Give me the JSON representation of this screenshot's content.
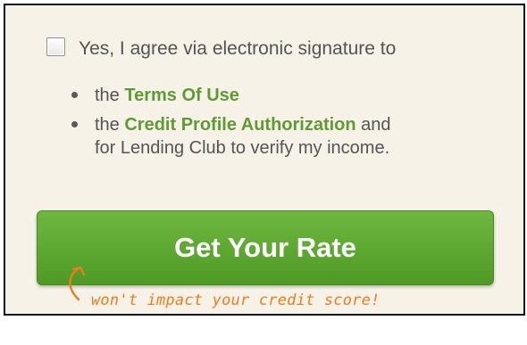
{
  "agreement": {
    "checked": false,
    "label": "Yes, I agree via electronic signature to"
  },
  "terms": [
    {
      "prefix": "the ",
      "link_text": "Terms Of Use",
      "suffix": ""
    },
    {
      "prefix": "the ",
      "link_text": "Credit Profile Authorization",
      "suffix": " and",
      "continuation": "for Lending Club to verify my income."
    }
  ],
  "cta": {
    "label": "Get Your Rate"
  },
  "note": {
    "text": "won't impact your credit score!"
  },
  "colors": {
    "link": "#5f9b32",
    "button": "#5aa630",
    "note": "#ea7d1c",
    "panel_background": "#f6f2e8"
  }
}
